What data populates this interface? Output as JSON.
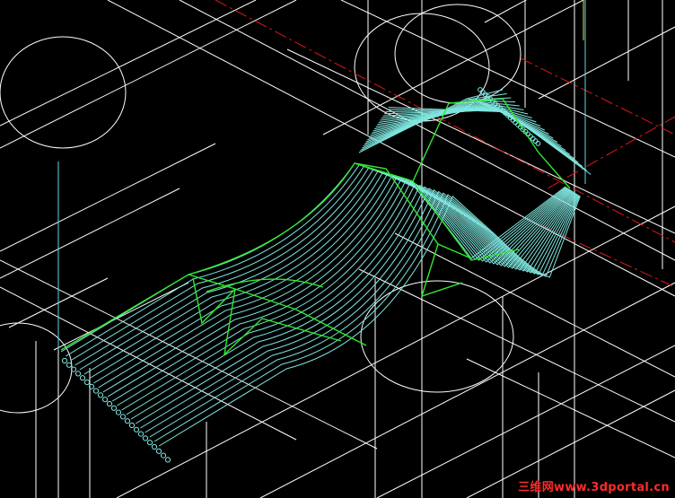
{
  "viewport": {
    "background": "#000000",
    "colors": {
      "wire": "#ffffff",
      "toolpath": "#7fe6df",
      "boundary": "#2ee82e",
      "centerline": "#e01818",
      "axis_cyan": "#5fd8e0",
      "axis_yellow": "#e8d84a"
    }
  },
  "watermark": {
    "text": "三维网www.3dportal.cn"
  }
}
